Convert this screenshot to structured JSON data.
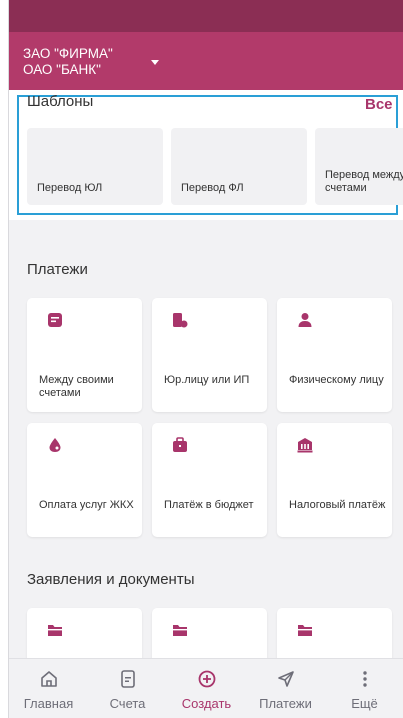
{
  "header": {
    "company_line1": "ЗАО \"ФИРМА\"",
    "company_line2": "ОАО \"БАНК\""
  },
  "templates": {
    "title": "Шаблоны",
    "all_label": "Все",
    "items": [
      {
        "label": "Перевод ЮЛ"
      },
      {
        "label": "Перевод ФЛ"
      },
      {
        "label": "Перевод между счетами"
      }
    ]
  },
  "payments": {
    "title": "Платежи",
    "items": [
      {
        "label": "Между своими счетами",
        "icon": "document-icon"
      },
      {
        "label": "Юр.лицу или ИП",
        "icon": "building-icon"
      },
      {
        "label": "Физическому лицу",
        "icon": "person-icon"
      },
      {
        "label": "Оплата услуг ЖКХ",
        "icon": "drop-icon"
      },
      {
        "label": "Платёж в бюджет",
        "icon": "briefcase-icon"
      },
      {
        "label": "Налоговый платёж",
        "icon": "bank-icon"
      }
    ]
  },
  "documents": {
    "title": "Заявления и документы",
    "items": [
      {
        "icon": "folder-icon"
      },
      {
        "icon": "folder-icon"
      },
      {
        "icon": "folder-icon"
      }
    ]
  },
  "nav": {
    "items": [
      {
        "label": "Главная",
        "icon": "home-icon"
      },
      {
        "label": "Счета",
        "icon": "account-icon"
      },
      {
        "label": "Создать",
        "icon": "add-circle-icon"
      },
      {
        "label": "Платежи",
        "icon": "send-icon"
      },
      {
        "label": "Ещё",
        "icon": "more-vertical-icon"
      }
    ],
    "active": "Создать"
  },
  "colors": {
    "status_bar": "#8b2e54",
    "header": "#b23a6a",
    "accent": "#a8356b",
    "highlight_frame": "#2a9fd6"
  }
}
